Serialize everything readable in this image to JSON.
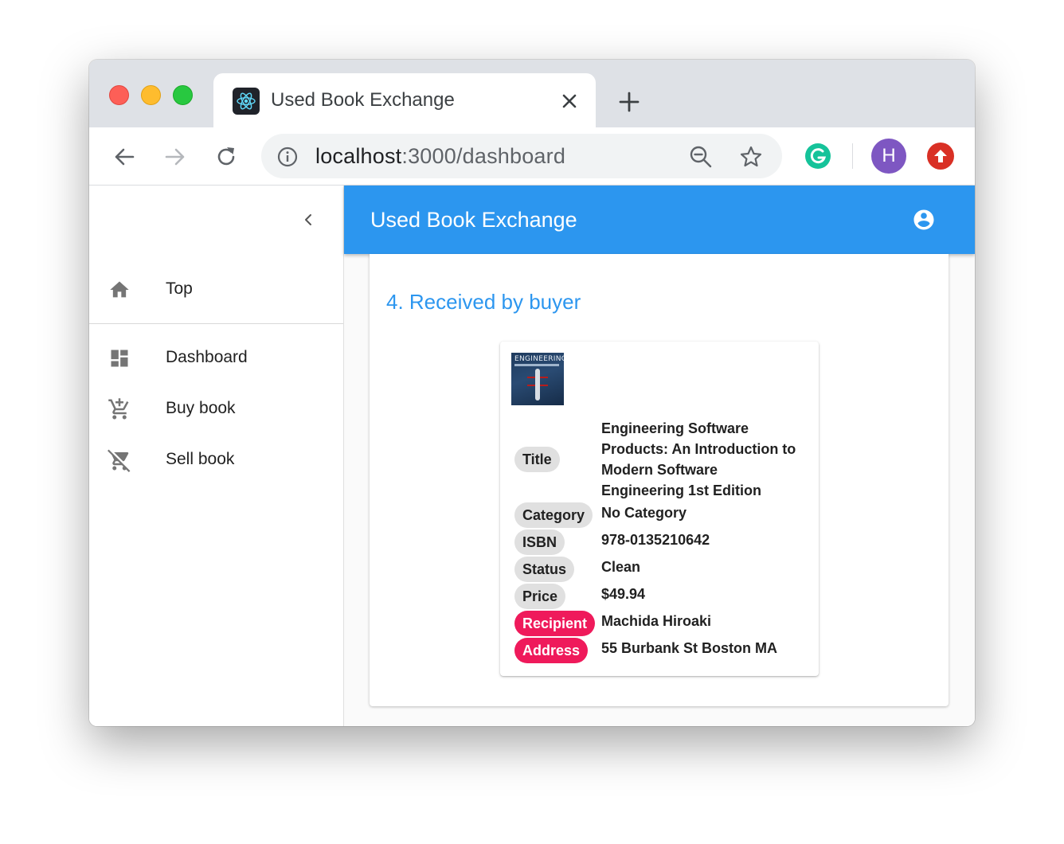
{
  "browser": {
    "tab_title": "Used Book Exchange",
    "url_host": "localhost",
    "url_path": ":3000/dashboard",
    "profile_initial": "H"
  },
  "drawer": {
    "top_item": {
      "label": "Top",
      "icon": "home-icon"
    },
    "items": [
      {
        "label": "Dashboard",
        "icon": "dashboard-icon"
      },
      {
        "label": "Buy book",
        "icon": "add-cart-icon"
      },
      {
        "label": "Sell book",
        "icon": "remove-cart-icon"
      }
    ]
  },
  "appbar": {
    "title": "Used Book Exchange"
  },
  "step": {
    "title": "4. Received by buyer"
  },
  "book": {
    "cover_text": "ENGINEERING",
    "fields": [
      {
        "label": "Title",
        "value": "Engineering Software Products: An Introduction to Modern Software Engineering 1st Edition",
        "highlight": false
      },
      {
        "label": "Category",
        "value": "No Category",
        "highlight": false
      },
      {
        "label": "ISBN",
        "value": "978-0135210642",
        "highlight": false
      },
      {
        "label": "Status",
        "value": "Clean",
        "highlight": false
      },
      {
        "label": "Price",
        "value": "$49.94",
        "highlight": false
      },
      {
        "label": "Recipient",
        "value": "Machida Hiroaki",
        "highlight": true
      },
      {
        "label": "Address",
        "value": "55 Burbank St Boston MA",
        "highlight": true
      }
    ]
  },
  "colors": {
    "primary": "#2c96ef",
    "accent": "#ef1a5b",
    "chip_bg": "#e0e0e0"
  }
}
